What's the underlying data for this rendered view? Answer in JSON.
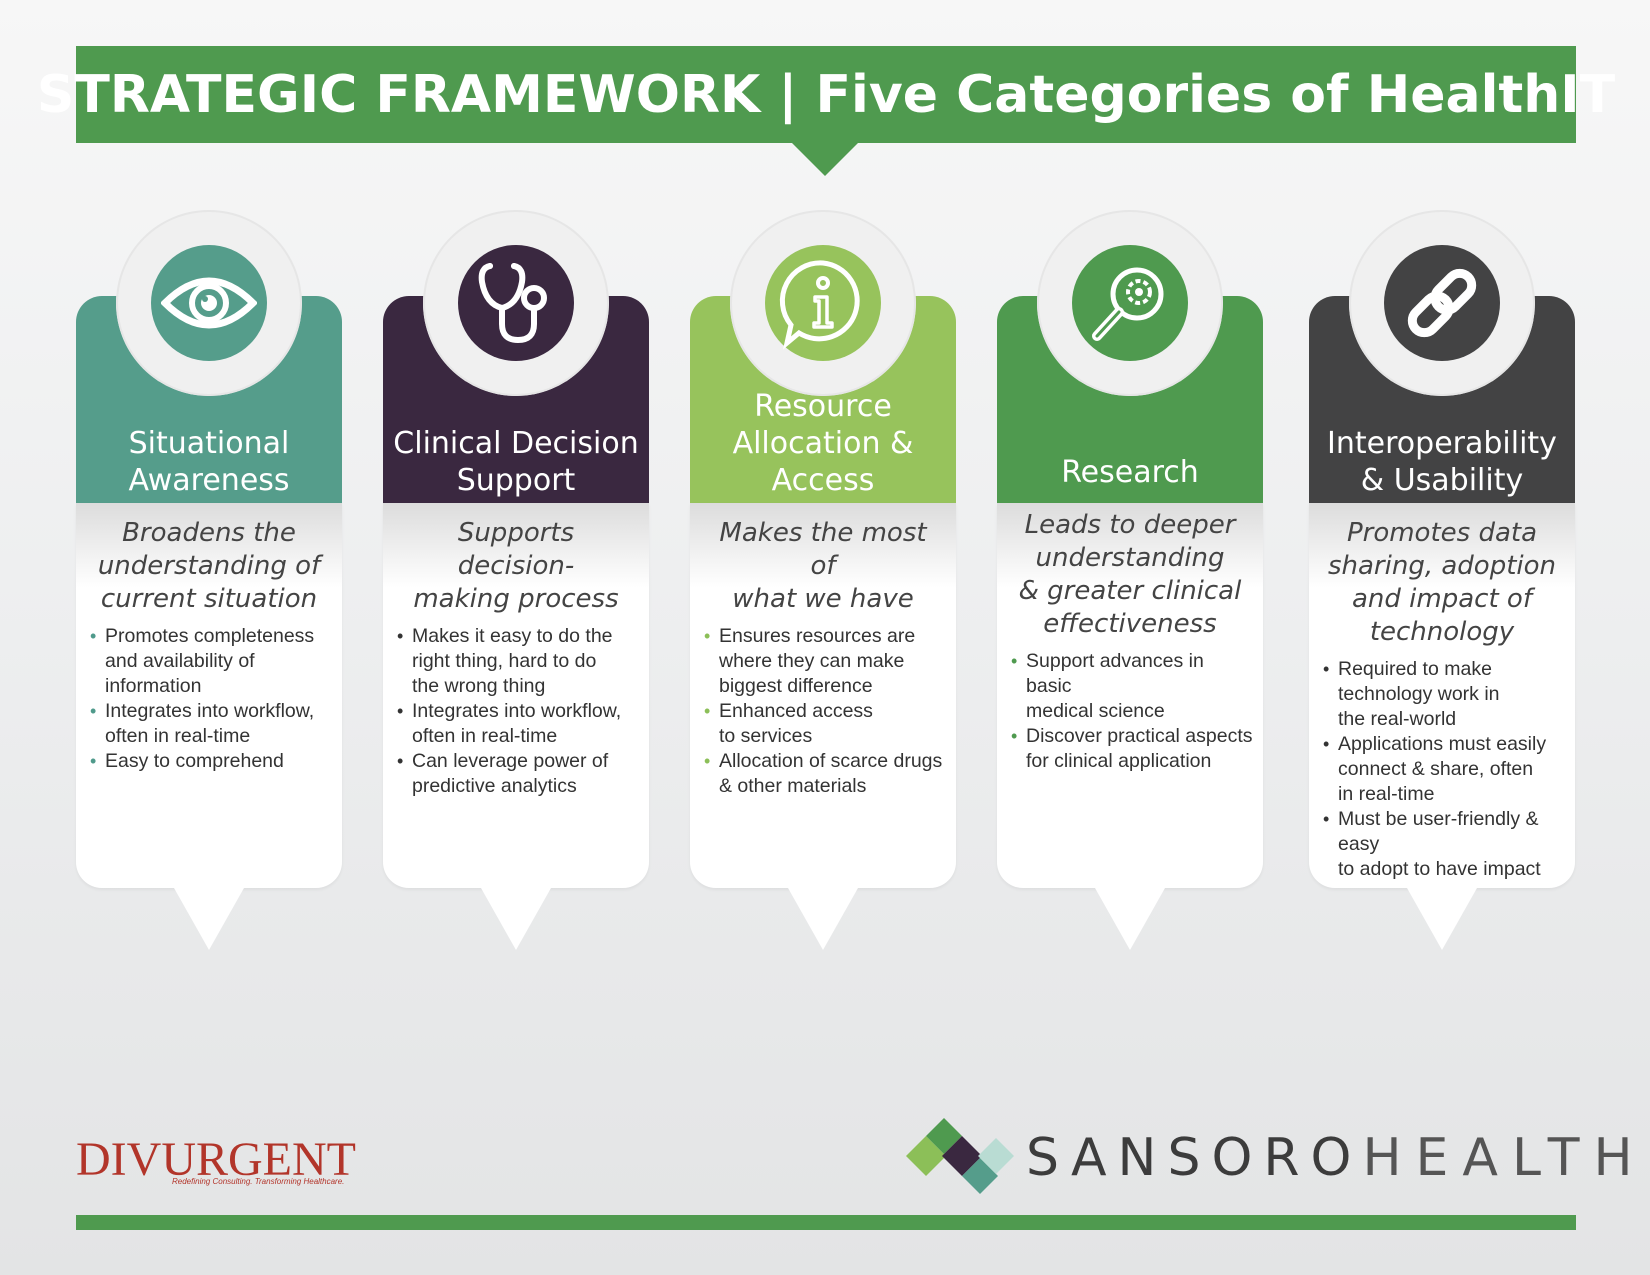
{
  "header": {
    "title": "STRATEGIC FRAMEWORK | Five Categories of HealthIT"
  },
  "colors": {
    "banner": "#4f9a4f",
    "teal": "#559d8b",
    "purple": "#3a2840",
    "light_green": "#97c35c",
    "green": "#4f9a4f",
    "charcoal": "#434344",
    "divurgent_red": "#b2352a"
  },
  "categories": [
    {
      "icon": "eye-icon",
      "title_lines": [
        "Situational",
        "Awareness"
      ],
      "tagline_lines": [
        "Broadens the",
        "understanding of",
        "current situation"
      ],
      "bullets": [
        [
          "Promotes completeness",
          "and availability of",
          "information"
        ],
        [
          "Integrates into workflow,",
          "often in real-time"
        ],
        [
          "Easy to comprehend"
        ]
      ]
    },
    {
      "icon": "stethoscope-icon",
      "title_lines": [
        "Clinical Decision",
        "Support"
      ],
      "tagline_lines": [
        "Supports decision-",
        "making process"
      ],
      "bullets": [
        [
          "Makes it easy to do the",
          "right thing, hard to do",
          "the wrong thing"
        ],
        [
          "Integrates into workflow,",
          "often in real-time"
        ],
        [
          "Can leverage power of",
          "predictive analytics"
        ]
      ]
    },
    {
      "icon": "info-bubble-icon",
      "title_lines": [
        "Resource",
        "Allocation &",
        "Access"
      ],
      "tagline_lines": [
        "Makes the most of",
        "what we have"
      ],
      "bullets": [
        [
          "Ensures resources are",
          "where they can make",
          "biggest difference"
        ],
        [
          "Enhanced access",
          "to services"
        ],
        [
          "Allocation of scarce drugs",
          "& other materials"
        ]
      ]
    },
    {
      "icon": "magnifier-gear-icon",
      "title_lines": [
        "Research"
      ],
      "tagline_lines": [
        "Leads to deeper",
        "understanding",
        "& greater clinical",
        "effectiveness"
      ],
      "bullets": [
        [
          "Support advances in basic",
          "medical science"
        ],
        [
          "Discover practical aspects",
          "for clinical application"
        ]
      ]
    },
    {
      "icon": "chain-link-icon",
      "title_lines": [
        "Interoperability",
        "& Usability"
      ],
      "tagline_lines": [
        "Promotes data",
        "sharing, adoption",
        "and impact of",
        "technology"
      ],
      "bullets": [
        [
          "Required to make",
          "technology work in",
          "the real-world"
        ],
        [
          "Applications must easily",
          "connect & share, often",
          "in real-time"
        ],
        [
          "Must be user-friendly & easy",
          "to adopt to have impact"
        ]
      ]
    }
  ],
  "footer": {
    "divurgent_logo": "DIVURGENT",
    "divurgent_tagline": "Redefining Consulting. Transforming Healthcare.",
    "sansoro_part1": "SANSORO",
    "sansoro_part2": "HEALTH"
  }
}
